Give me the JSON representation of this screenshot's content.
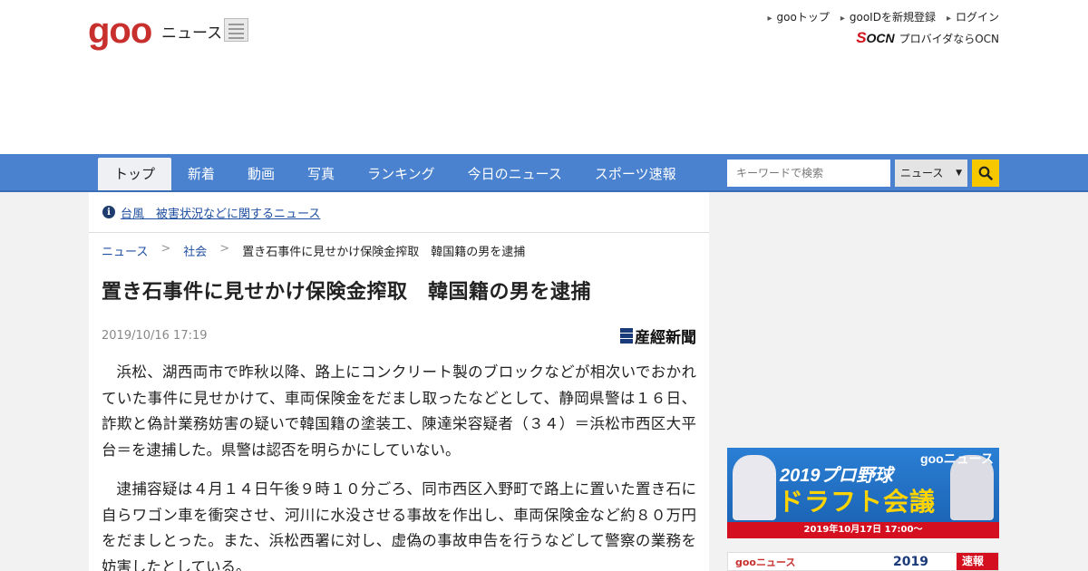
{
  "header": {
    "logo": "goo",
    "section": "ニュース",
    "links": [
      "gooトップ",
      "gooIDを新規登録",
      "ログイン"
    ],
    "ocn_logo": "OCN",
    "ocn_text": "プロバイダならOCN"
  },
  "nav": {
    "items": [
      "トップ",
      "新着",
      "動画",
      "写真",
      "ランキング",
      "今日のニュース",
      "スポーツ速報"
    ],
    "search_placeholder": "キーワードで検索",
    "search_scope": "ニュース"
  },
  "alert": {
    "text": "台風　被害状況などに関するニュース"
  },
  "breadcrumb": {
    "items": [
      "ニュース",
      "社会"
    ],
    "current": "置き石事件に見せかけ保険金搾取　韓国籍の男を逮捕"
  },
  "article": {
    "title": "置き石事件に見せかけ保険金搾取　韓国籍の男を逮捕",
    "date": "2019/10/16 17:19",
    "source": "産經新聞",
    "paragraphs": [
      "浜松、湖西両市で昨秋以降、路上にコンクリート製のブロックなどが相次いでおかれていた事件に見せかけて、車両保険金をだまし取ったなどとして、静岡県警は１６日、詐欺と偽計業務妨害の疑いで韓国籍の塗装工、陳達栄容疑者（３４）＝浜松市西区大平台＝を逮捕した。県警は認否を明らかにしていない。",
      "逮捕容疑は４月１４日午後９時１０分ごろ、同市西区入野町で路上に置いた置き石に自らワゴン車を衝突させ、河川に水没させる事故を作出し、車両保険金など約８０万円をだましとった。また、浜松西署に対し、虚偽の事故申告を行うなどして警察の業務を妨害したとしている。"
    ]
  },
  "sidebar": {
    "banner1": {
      "brand": "gooニュース",
      "line1": "2019プロ野球",
      "line2": "ドラフト会議",
      "date": "2019年10月17日 17:00〜"
    },
    "banner2": {
      "brand": "gooニュース",
      "year": "2019",
      "badge": "速報"
    }
  },
  "colors": {
    "nav": "#4a82cf",
    "logo": "#c8302e",
    "link": "#1f4fa0",
    "search_button": "#f5c800"
  }
}
